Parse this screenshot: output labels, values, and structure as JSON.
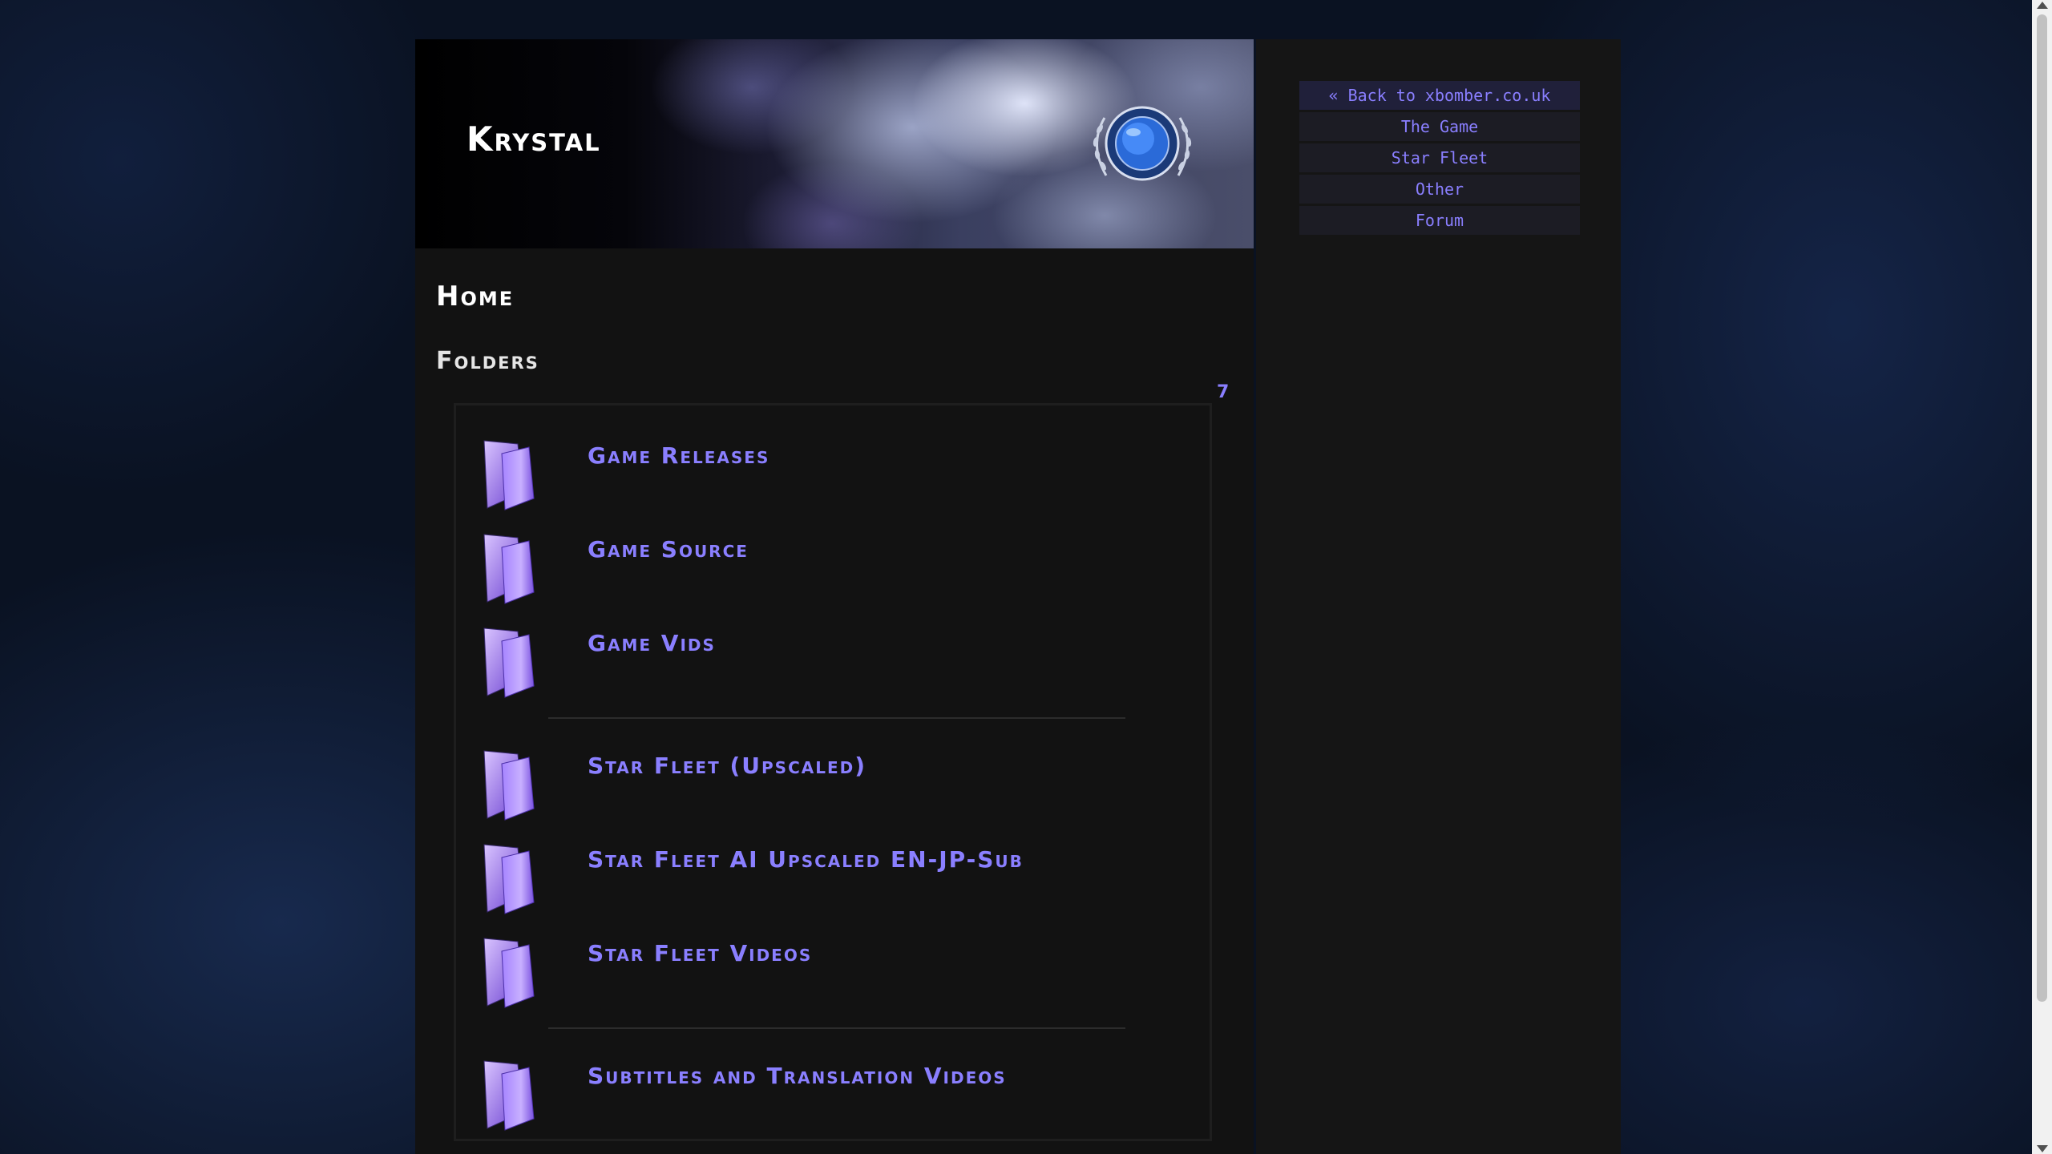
{
  "site": {
    "title": "Krystal"
  },
  "page": {
    "heading": "Home"
  },
  "folders": {
    "heading": "Folders",
    "count": "7",
    "items": [
      {
        "label": "Game Releases"
      },
      {
        "label": "Game Source"
      },
      {
        "label": "Game Vids"
      },
      {
        "label": "Star Fleet (Upscaled)"
      },
      {
        "label": "Star Fleet AI Upscaled EN-JP-Sub"
      },
      {
        "label": "Star Fleet Videos"
      },
      {
        "label": "Subtitles and Translation Videos"
      }
    ]
  },
  "nav": {
    "items": [
      {
        "label": "« Back to xbomber.co.uk"
      },
      {
        "label": "The Game"
      },
      {
        "label": "Star Fleet"
      },
      {
        "label": "Other"
      },
      {
        "label": "Forum"
      }
    ]
  },
  "colors": {
    "accent": "#8a7fff",
    "panel": "#121212",
    "background": "#0a1222"
  },
  "icons": {
    "folder": "folder-icon",
    "emblem": "star-fleet-emblem"
  }
}
